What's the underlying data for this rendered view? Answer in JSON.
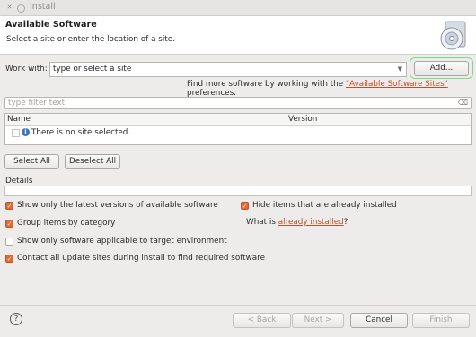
{
  "window": {
    "title": "Install"
  },
  "header": {
    "title": "Available Software",
    "subtitle": "Select a site or enter the location of a site."
  },
  "work_with": {
    "label": "Work with:",
    "value": "type or select a site",
    "add_label": "Add...",
    "find_more_prefix": "Find more software by working with the ",
    "find_more_link": "\"Available Software Sites\"",
    "find_more_suffix": " preferences."
  },
  "filter": {
    "placeholder": "type filter text"
  },
  "table": {
    "columns": [
      "Name",
      "Version"
    ],
    "empty_message": "There is no site selected."
  },
  "selection": {
    "select_all": "Select All",
    "deselect_all": "Deselect All"
  },
  "details": {
    "label": "Details"
  },
  "options": {
    "latest_versions": {
      "label": "Show only the latest versions of available software",
      "checked": true
    },
    "group_by_category": {
      "label": "Group items by category",
      "checked": true
    },
    "target_env": {
      "label": "Show only software applicable to target environment",
      "checked": false
    },
    "contact_sites": {
      "label": "Contact all update sites during install to find required software",
      "checked": true
    },
    "hide_installed": {
      "label": "Hide items that are already installed",
      "checked": true
    },
    "what_installed_prefix": "What is ",
    "what_installed_link": "already installed",
    "what_installed_suffix": "?"
  },
  "footer": {
    "back": "< Back",
    "next": "Next >",
    "cancel": "Cancel",
    "finish": "Finish"
  },
  "colors": {
    "accent": "#e06a36",
    "link": "#c0502b",
    "highlight": "#7ed98a"
  }
}
